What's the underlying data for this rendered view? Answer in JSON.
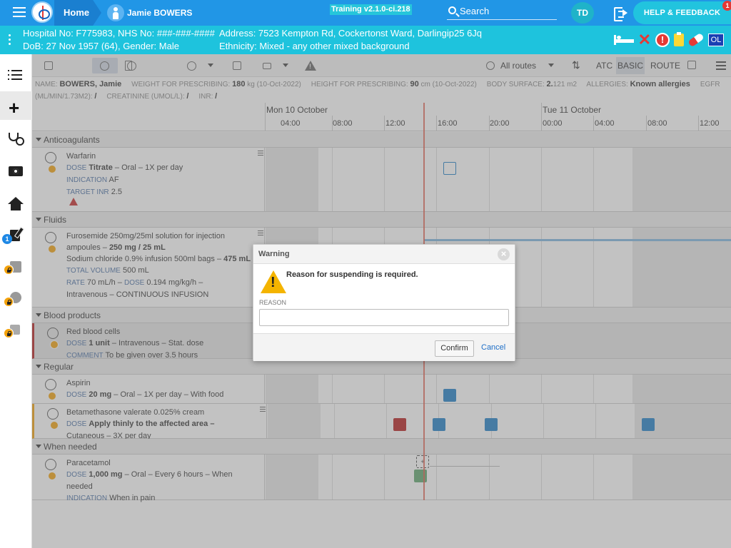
{
  "topbar": {
    "home_label": "Home",
    "patient_name": "Jamie BOWERS",
    "training_label": "Training v2.1.0-ci.218",
    "search_label": "Search",
    "avatar_initials": "TD",
    "help_label": "HELP & FEEDBACK",
    "help_badge": "1"
  },
  "patientbar": {
    "line1_left": "Hospital No: F775983, NHS No: ###-###-####",
    "line1_right": "Address: 7523 Kempton Rd, Cockertonst Ward, Darlingip25 6Jq",
    "line2_left": "DoB: 27 Nov 1957 (64), Gender: Male",
    "line2_right": "Ethnicity: Mixed - any other mixed background",
    "badge_ol": "OL"
  },
  "leftnav": {
    "edit_badge": "1"
  },
  "toolbar": {
    "routes_label": "All routes",
    "atc_label": "ATC",
    "basic_label": "BASIC",
    "route_label": "ROUTE"
  },
  "info": {
    "name_label": "NAME:",
    "name_value": "BOWERS, Jamie",
    "weight_label": "WEIGHT FOR PRESCRIBING:",
    "weight_value": "180",
    "weight_suffix": "kg (10-Oct-2022)",
    "height_label": "HEIGHT FOR PRESCRIBING:",
    "height_value": "90",
    "height_suffix": "cm (10-Oct-2022)",
    "bsa_label": "BODY SURFACE:",
    "bsa_value": "2.",
    "bsa_suffix": "121 m2",
    "allergies_label": "ALLERGIES:",
    "allergies_value": "Known allergies",
    "egfr_label": "EGFR",
    "egfr_unit": "(ML/MIN/1.73M2):",
    "egfr_value": "/",
    "creat_label": "CREATININE (UMOL/L):",
    "creat_value": "/",
    "inr_label": "INR:",
    "inr_value": "/"
  },
  "timeline": {
    "day1": "Mon 10 October",
    "day2": "Tue 11 October",
    "hours": [
      "04:00",
      "08:00",
      "12:00",
      "16:00",
      "20:00",
      "00:00",
      "04:00",
      "08:00",
      "12:00"
    ]
  },
  "sections": {
    "anticoagulants": "Anticoagulants",
    "fluids": "Fluids",
    "blood": "Blood products",
    "regular": "Regular",
    "when_needed": "When needed"
  },
  "meds": {
    "warfarin": {
      "name": "Warfarin",
      "dose_label": "DOSE",
      "dose_value": "Titrate",
      "dose_rest": "– Oral – 1X per day",
      "ind_label": "INDICATION",
      "ind_value": "AF",
      "inr_label": "TARGET INR",
      "inr_value": "2.5"
    },
    "furosemide": {
      "name": "Furosemide 250mg/25ml solution for injection ampoules –",
      "name_bold": "250 mg / 25 mL",
      "line2": "Sodium chloride 0.9% infusion 500ml bags –",
      "line2_bold": "475 mL",
      "vol_label": "TOTAL VOLUME",
      "vol_value": "500 mL",
      "rate_label": "RATE",
      "rate_value": "70 mL/h –",
      "dose_label": "DOSE",
      "dose_value": "0.194 mg/kg/h –",
      "line_last": "Intravenous – CONTINUOUS INFUSION"
    },
    "rbc": {
      "name": "Red blood cells",
      "dose_label": "DOSE",
      "dose_value": "1 unit",
      "dose_rest": "– Intravenous – Stat. dose",
      "comment_label": "COMMENT",
      "comment_value": "To be given over 3.5 hours"
    },
    "aspirin": {
      "name": "Aspirin",
      "dose_label": "DOSE",
      "dose_value": "20 mg",
      "dose_rest": "– Oral – 1X per day – With food"
    },
    "betamethasone": {
      "name": "Betamethasone valerate 0.025% cream",
      "dose_label": "DOSE",
      "dose_value": "Apply thinly to the affected area –",
      "dose_rest": "Cutaneous – 3X per day"
    },
    "paracetamol": {
      "name": "Paracetamol",
      "dose_label": "DOSE",
      "dose_value": "1,000 mg",
      "dose_rest": "– Oral – Every 6 hours – When needed",
      "ind_label": "INDICATION",
      "ind_value": "When in pain"
    }
  },
  "dialog": {
    "title": "Warning",
    "message": "Reason for suspending is required.",
    "reason_label": "REASON",
    "reason_value": "",
    "confirm_label": "Confirm",
    "cancel_label": "Cancel"
  },
  "colors": {
    "topbar": "#2196e6",
    "patientbar": "#1ec3dd",
    "dose_blue": "#1e7fc6",
    "dose_red": "#b71c1c",
    "dose_green": "#5fa66e"
  }
}
